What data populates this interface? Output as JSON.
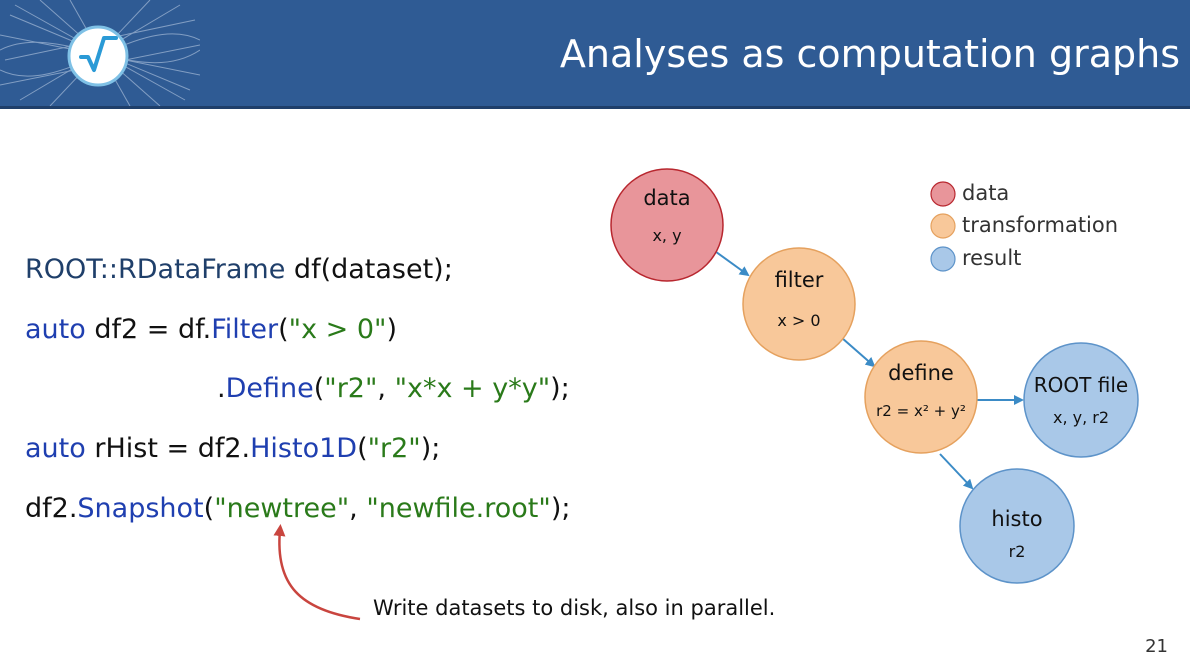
{
  "slide": {
    "title": "Analyses as computation graphs",
    "page_number": "21"
  },
  "code": {
    "line1": {
      "type": "ROOT::RDataFrame",
      "rest": " df(dataset);"
    },
    "line2": {
      "kw": "auto",
      "mid": " df2 = df.",
      "method": "Filter",
      "open": "(",
      "arg": "\"x > 0\"",
      "close": ")"
    },
    "line3": {
      "dot": ".",
      "method": "Define",
      "open": "(",
      "arg1": "\"r2\"",
      "sep": ", ",
      "arg2": "\"x*x + y*y\"",
      "close": ");"
    },
    "line4": {
      "kw": "auto",
      "mid": " rHist = df2.",
      "method": "Histo1D",
      "open": "(",
      "arg": "\"r2\"",
      "close": ");"
    },
    "line5": {
      "obj": "df2.",
      "method": "Snapshot",
      "open": "(",
      "arg1": "\"newtree\"",
      "sep": ", ",
      "arg2": "\"newfile.root\"",
      "close": ");"
    }
  },
  "annotation": "Write datasets to disk, also in parallel.",
  "graph": {
    "nodes": [
      {
        "id": "data",
        "title": "data",
        "subtitle": "x, y",
        "kind": "data"
      },
      {
        "id": "filter",
        "title": "filter",
        "subtitle": "x > 0",
        "kind": "transformation"
      },
      {
        "id": "define",
        "title": "define",
        "subtitle": "r2 = x² + y²",
        "kind": "transformation"
      },
      {
        "id": "rootfile",
        "title": "ROOT file",
        "subtitle": "x, y, r2",
        "kind": "result"
      },
      {
        "id": "histo",
        "title": "histo",
        "subtitle": "r2",
        "kind": "result"
      }
    ],
    "legend": [
      {
        "label": "data",
        "color": "#e8959a"
      },
      {
        "label": "transformation",
        "color": "#f8c89a"
      },
      {
        "label": "result",
        "color": "#a9c8e8"
      }
    ]
  },
  "colors": {
    "header": "#2f5b94",
    "data_fill": "#e8959a",
    "transformation_fill": "#f8c89a",
    "result_fill": "#a9c8e8",
    "edge": "#3b8bc6",
    "annotation_arrow": "#c9453f"
  }
}
